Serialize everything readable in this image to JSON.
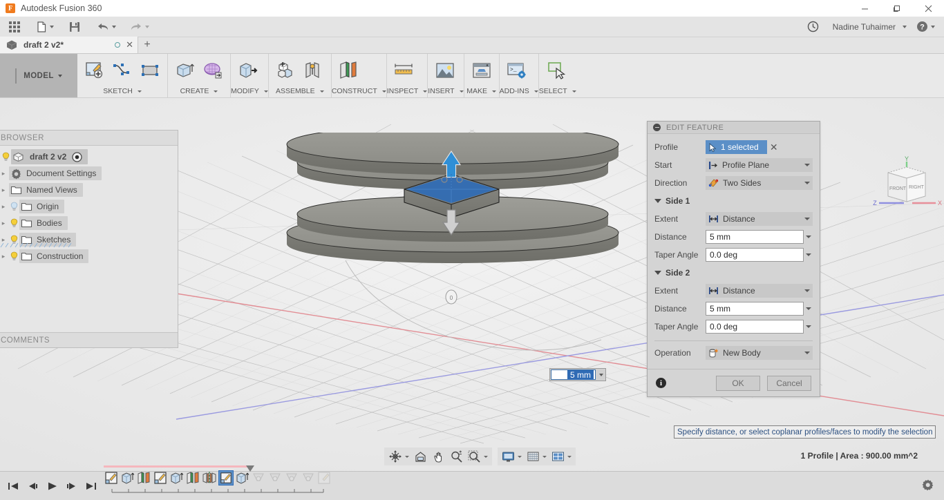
{
  "window": {
    "app_title": "Autodesk Fusion 360",
    "logo_letter": "F",
    "minimize": "—",
    "maximize": "❐",
    "close": "✕"
  },
  "quick_access": {
    "grid_icon": "app-grid-icon",
    "new_icon": "new-document-icon",
    "save_icon": "save-icon",
    "undo_icon": "undo-icon",
    "redo_icon": "redo-icon",
    "history_icon": "recent-history-icon",
    "user_name": "Nadine Tuhaimer",
    "help_icon": "help-icon"
  },
  "tabs": {
    "document_name": "draft 2 v2*",
    "new_tab": "+"
  },
  "ribbon": {
    "workspace_label": "MODEL",
    "panels": [
      {
        "label": "SKETCH",
        "buttons": [
          "create-sketch-icon",
          "spline-icon",
          "rectangle-icon"
        ]
      },
      {
        "label": "CREATE",
        "buttons": [
          "extrude-icon",
          "revolve-grid-icon"
        ]
      },
      {
        "label": "MODIFY",
        "buttons": [
          "press-pull-icon"
        ]
      },
      {
        "label": "ASSEMBLE",
        "buttons": [
          "new-component-icon",
          "joint-icon"
        ]
      },
      {
        "label": "CONSTRUCT",
        "buttons": [
          "offset-plane-icon"
        ]
      },
      {
        "label": "INSPECT",
        "buttons": [
          "measure-icon"
        ]
      },
      {
        "label": "INSERT",
        "buttons": [
          "insert-image-icon"
        ]
      },
      {
        "label": "MAKE",
        "buttons": [
          "3d-print-icon"
        ]
      },
      {
        "label": "ADD-INS",
        "buttons": [
          "scripts-addins-icon"
        ]
      },
      {
        "label": "SELECT",
        "buttons": [
          "select-icon"
        ]
      }
    ]
  },
  "browser": {
    "header": "BROWSER",
    "footer": "COMMENTS",
    "root": {
      "label": "draft 2 v2",
      "bulb": "on",
      "body_icon": "component-icon",
      "target_icon": "display-state-icon"
    },
    "items": [
      {
        "label": "Document Settings",
        "icon": "gear-icon",
        "bulb": "none"
      },
      {
        "label": "Named Views",
        "icon": "folder-icon",
        "bulb": "none"
      },
      {
        "label": "Origin",
        "icon": "folder-icon",
        "bulb": "off"
      },
      {
        "label": "Bodies",
        "icon": "folder-icon",
        "bulb": "on"
      },
      {
        "label": "Sketches",
        "icon": "folder-sketch-icon",
        "bulb": "on"
      },
      {
        "label": "Construction",
        "icon": "folder-icon",
        "bulb": "on"
      }
    ]
  },
  "dialog": {
    "title": "EDIT FEATURE",
    "rows": [
      {
        "label": "Profile",
        "type": "select",
        "value": "1 selected",
        "icon": "cursor-arrow-icon",
        "clear": "✕"
      },
      {
        "label": "Start",
        "type": "combo",
        "value": "Profile Plane",
        "icon": "profile-plane-icon"
      },
      {
        "label": "Direction",
        "type": "combo",
        "value": "Two Sides",
        "icon": "two-sides-icon"
      }
    ],
    "side1": {
      "title": "Side 1",
      "extent_label": "Extent",
      "extent_value": "Distance",
      "extent_icon": "distance-icon",
      "distance_label": "Distance",
      "distance_value": "5 mm",
      "taper_label": "Taper Angle",
      "taper_value": "0.0 deg"
    },
    "side2": {
      "title": "Side 2",
      "extent_label": "Extent",
      "extent_value": "Distance",
      "extent_icon": "distance-icon",
      "distance_label": "Distance",
      "distance_value": "5 mm",
      "taper_label": "Taper Angle",
      "taper_value": "0.0 deg"
    },
    "operation": {
      "label": "Operation",
      "value": "New Body",
      "icon": "new-body-icon"
    },
    "footer": {
      "info_icon": "info-icon",
      "ok": "OK",
      "cancel": "Cancel"
    },
    "accent_color": "#5b8fc7"
  },
  "viewport": {
    "inline_input_value": "5 mm",
    "hint_text": "Specify distance, or select coplanar profiles/faces to modify the selection",
    "status_text": "1 Profile | Area : 900.00 mm^2",
    "manipulator_up_label": "0",
    "manipulator_down_label": "0",
    "viewcube": {
      "front": "FRONT",
      "right": "RIGHT",
      "x": "X",
      "y": "Y",
      "z": "Z"
    }
  },
  "navbar": {
    "buttons": [
      "orbit-icon",
      "look-at-icon",
      "pan-icon",
      "zoom-icon",
      "zoom-window-icon",
      "display-settings-icon",
      "grid-snaps-icon",
      "viewports-icon"
    ]
  },
  "timeline": {
    "nav": [
      "go-to-beginning-icon",
      "step-back-icon",
      "play-icon",
      "step-forward-icon",
      "go-to-end-icon"
    ],
    "features": [
      {
        "icon": "sketch-icon",
        "state": "done"
      },
      {
        "icon": "extrude-icon",
        "state": "done"
      },
      {
        "icon": "plane-icon",
        "state": "done"
      },
      {
        "icon": "sketch-icon",
        "state": "done"
      },
      {
        "icon": "extrude-icon",
        "state": "done"
      },
      {
        "icon": "plane-icon",
        "state": "done"
      },
      {
        "icon": "mirror-icon",
        "state": "done"
      },
      {
        "icon": "sketch-icon",
        "state": "selected"
      },
      {
        "icon": "extrude-icon",
        "state": "done"
      },
      {
        "icon": "revolve-icon",
        "state": "pending"
      },
      {
        "icon": "revolve-icon",
        "state": "pending"
      },
      {
        "icon": "revolve-icon",
        "state": "pending"
      },
      {
        "icon": "revolve-icon",
        "state": "pending"
      },
      {
        "icon": "sketch-icon",
        "state": "pending"
      }
    ],
    "settings_icon": "gear-icon"
  }
}
